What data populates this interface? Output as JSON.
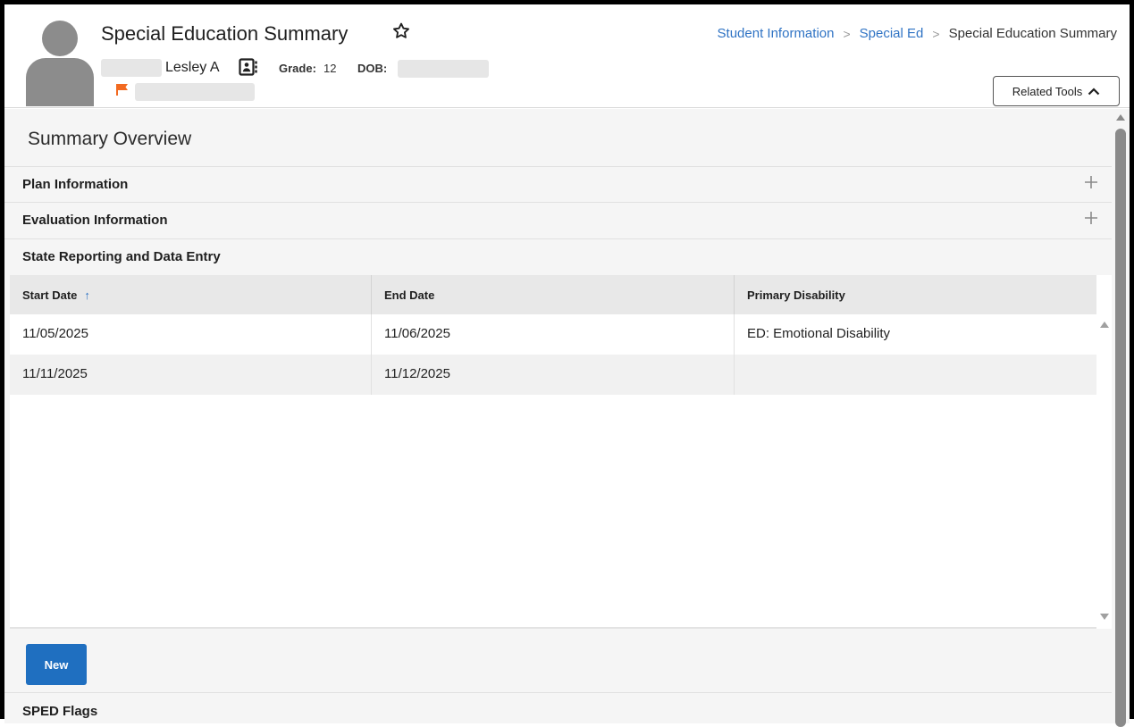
{
  "header": {
    "title": "Special Education Summary",
    "student_name": "Lesley A",
    "grade_label": "Grade:",
    "grade_value": "12",
    "dob_label": "DOB:",
    "related_tools_label": "Related Tools"
  },
  "breadcrumb": {
    "items": [
      "Student Information",
      "Special Ed",
      "Special Education Summary"
    ]
  },
  "main": {
    "section_title": "Summary Overview",
    "panels": [
      "Plan Information",
      "Evaluation Information",
      "State Reporting and Data Entry"
    ],
    "table": {
      "columns": [
        "Start Date",
        "End Date",
        "Primary Disability"
      ],
      "rows": [
        [
          "11/05/2025",
          "11/06/2025",
          "ED: Emotional Disability"
        ],
        [
          "11/11/2025",
          "11/12/2025",
          ""
        ]
      ]
    },
    "new_button_label": "New",
    "sped_flags_label": "SPED Flags"
  },
  "colors": {
    "accent": "#1f6fc0",
    "link": "#2f73c4",
    "flag": "#f26a21",
    "avatar": "#8c8c8c"
  },
  "icons": [
    "star-icon",
    "contact-card-icon",
    "flag-icon",
    "chevron-up-icon",
    "plus-icon",
    "sort-up-arrow-icon"
  ]
}
